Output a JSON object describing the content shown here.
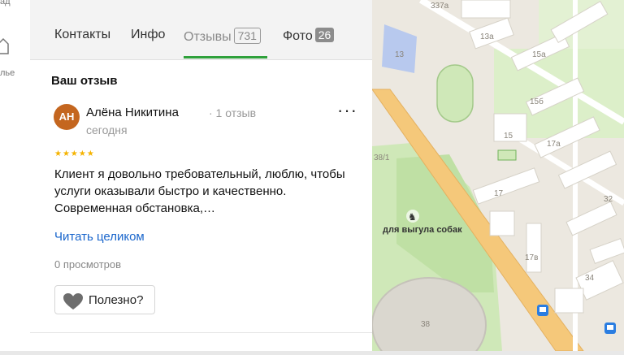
{
  "rail": {
    "top_fragment": "ад",
    "label_fragment": "лье"
  },
  "tabs": [
    {
      "label": "Контакты"
    },
    {
      "label": "Инфо"
    },
    {
      "label": "Отзывы",
      "badge": "731"
    },
    {
      "label": "Фото",
      "badge": "26"
    }
  ],
  "section_title": "Ваш отзыв",
  "review": {
    "avatar_initials": "АН",
    "author": "Алёна Никитина",
    "author_reviews": "· 1 отзыв",
    "date": "сегодня",
    "rating": 5,
    "stars": "★★★★★",
    "text": "Клиент я довольно требовательный, люблю, чтобы услуги оказывали быстро и качественно. Современная обстановка,…",
    "read_more": "Читать целиком",
    "views": "0 просмотров",
    "helpful": "Полезно?"
  },
  "map": {
    "labels": {
      "b337a": "337а",
      "b13a": "13а",
      "b13": "13",
      "b15a": "15а",
      "b15b": "15б",
      "b15": "15",
      "b17a": "17а",
      "b17": "17",
      "b32": "32",
      "b17v": "17в",
      "b34": "34",
      "b38": "38",
      "b38_1": "38/1",
      "dog": "для выгула собак"
    },
    "colors": {
      "road": "#f5c87a",
      "park": "#cfe8b8",
      "building": "#ffffff",
      "water": "#b8c9ee"
    }
  }
}
